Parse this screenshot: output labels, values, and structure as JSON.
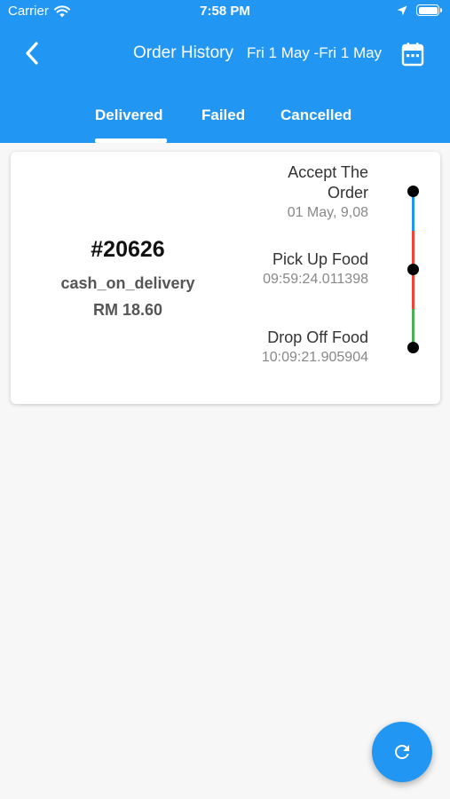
{
  "status_bar": {
    "carrier": "Carrier",
    "time": "7:58 PM",
    "icons": [
      "wifi-icon",
      "location-arrow-icon",
      "battery-icon"
    ]
  },
  "header": {
    "title": "Order History",
    "date_range": "Fri 1 May -Fri 1 May",
    "back_icon": "chevron-left-icon",
    "calendar_icon": "calendar-icon",
    "background_color": "#2196f3"
  },
  "tabs": [
    {
      "label": "Delivered",
      "selected": true
    },
    {
      "label": "Failed",
      "selected": false
    },
    {
      "label": "Cancelled",
      "selected": false
    }
  ],
  "orders": [
    {
      "order_no": "#20626",
      "payment_method": "cash_on_delivery",
      "amount": "RM 18.60",
      "steps": [
        {
          "label": "Accept The Order",
          "time": "01 May, 9,08"
        },
        {
          "label": "Pick Up Food",
          "time": "09:59:24.011398"
        },
        {
          "label": "Drop Off Food",
          "time": "10:09:21.905904"
        }
      ],
      "timeline_colors": {
        "segment_1": [
          "#2196f3",
          "#f44336"
        ],
        "segment_2": [
          "#f44336",
          "#4caf50"
        ],
        "dot": "#000000"
      }
    }
  ],
  "fab": {
    "icon": "refresh-icon",
    "color": "#2196f3"
  }
}
